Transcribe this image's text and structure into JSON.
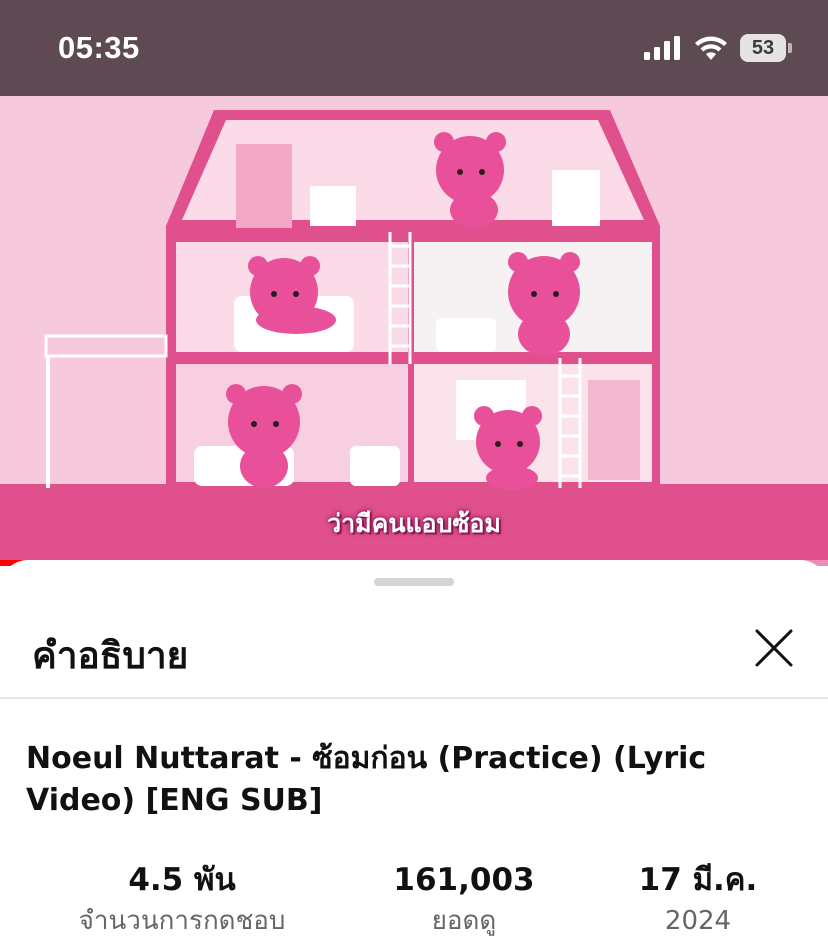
{
  "status_bar": {
    "time": "05:35",
    "battery": "53"
  },
  "video": {
    "caption": "ว่ามีคนแอบซ้อม",
    "progress_fraction": 0.11,
    "buffer_fraction": 0.22,
    "accent_color": "#ff0000"
  },
  "description_sheet": {
    "title": "คำอธิบาย",
    "video_title": "Noeul Nuttarat - ซ้อมก่อน (Practice) (Lyric Video) [ENG SUB]",
    "stats": {
      "likes_value": "4.5 พัน",
      "likes_label": "จำนวนการกดชอบ",
      "views_value": "161,003",
      "views_label": "ยอดดู",
      "date_value": "17 มี.ค.",
      "date_label": "2024"
    }
  }
}
